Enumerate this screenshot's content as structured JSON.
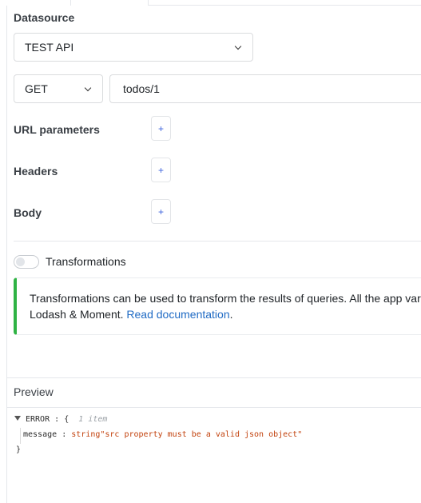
{
  "datasource": {
    "label": "Datasource",
    "selected": "TEST API"
  },
  "request": {
    "method": "GET",
    "url": "todos/1"
  },
  "sections": {
    "url_params": {
      "label": "URL parameters",
      "add": "+"
    },
    "headers": {
      "label": "Headers",
      "add": "+"
    },
    "body": {
      "label": "Body",
      "add": "+"
    }
  },
  "transformations": {
    "label": "Transformations",
    "enabled": false,
    "info_text": "Transformations can be used to transform the results of queries. All the app var",
    "info_text_2": "Lodash & Moment. ",
    "link_text": "Read documentation",
    "trailing": "."
  },
  "preview": {
    "title": "Preview",
    "root_key": "ERROR",
    "colon": ":",
    "open_brace": "{",
    "item_count": "1 item",
    "entry_key": "message",
    "entry_type": "string",
    "entry_value": "\"src property must be a valid json object\"",
    "close_brace": "}"
  },
  "colors": {
    "accent": "#3e63dd",
    "success_bar": "#2fb344",
    "link": "#206bc4",
    "json_string": "#c2410c"
  }
}
